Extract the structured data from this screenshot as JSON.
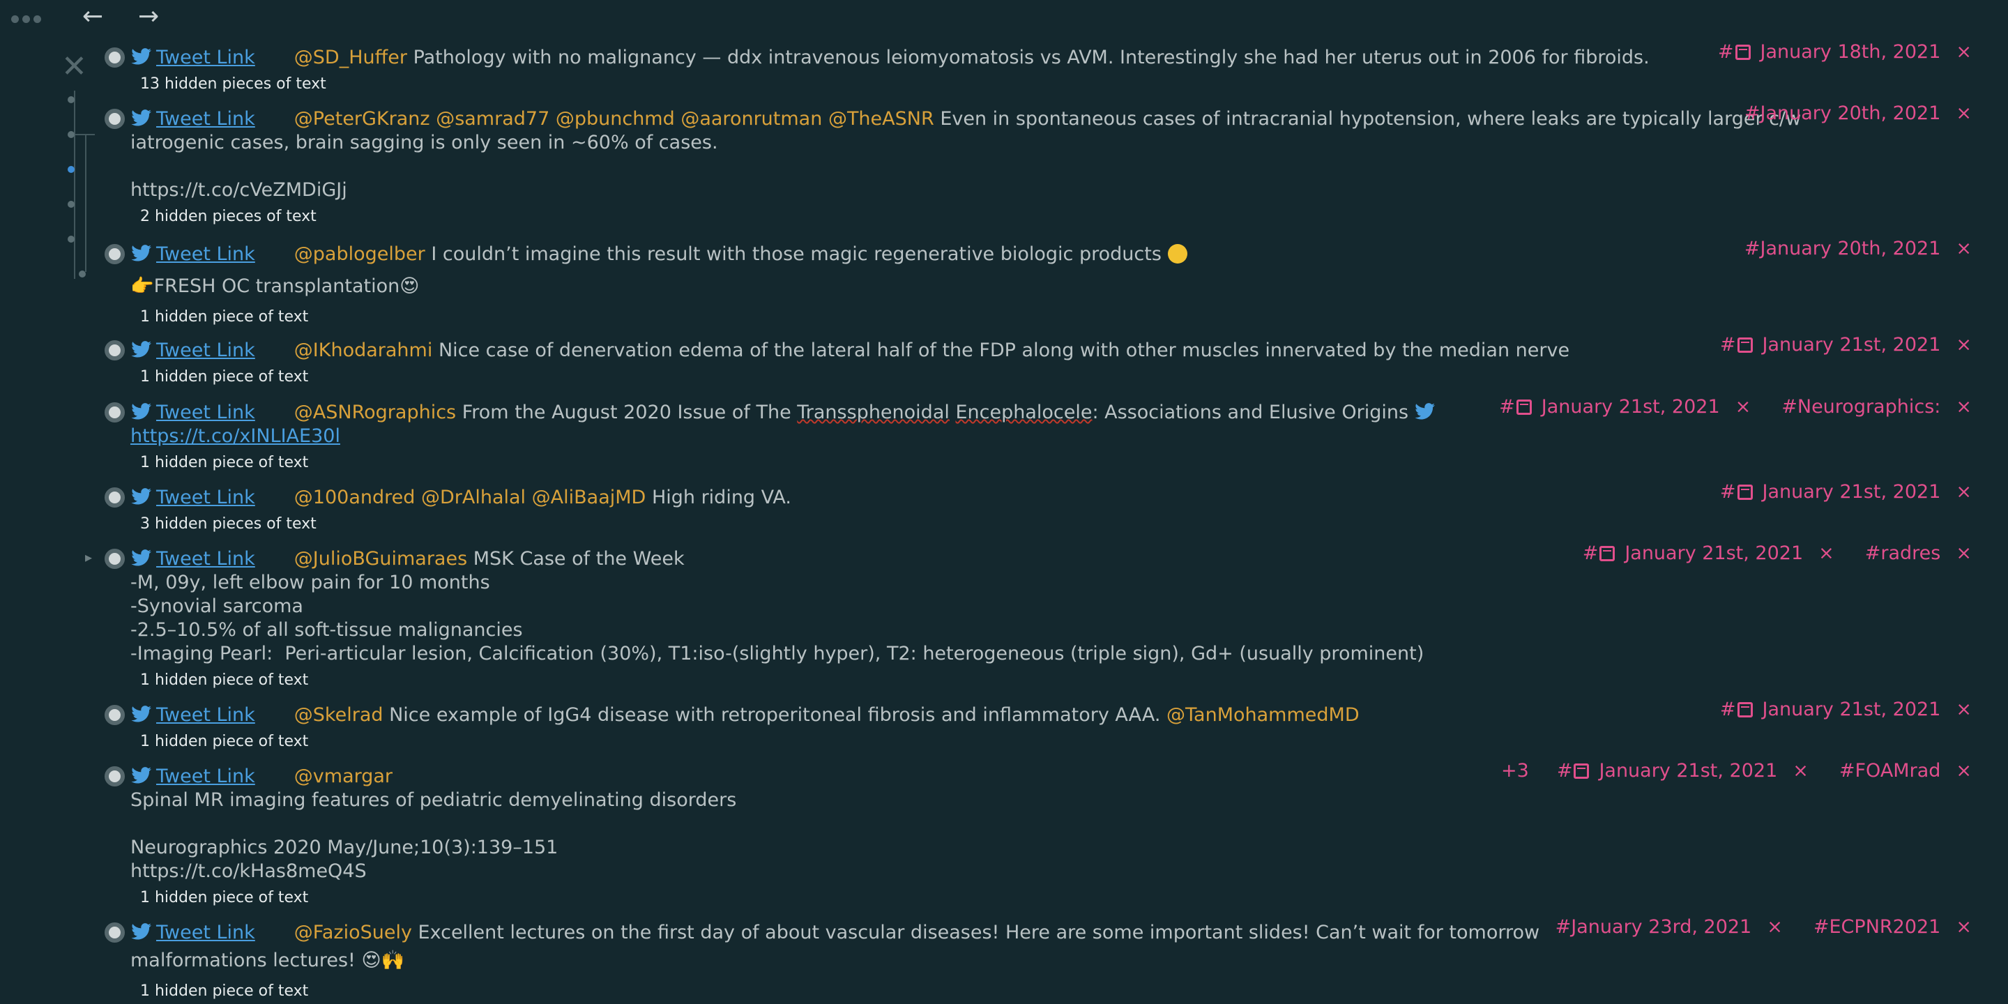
{
  "nav": {
    "menu_icon": "ellipsis-icon",
    "back_icon": "arrow-left-icon",
    "forward_icon": "arrow-right-icon",
    "back_glyph": "←",
    "forward_glyph": "→",
    "close_glyph": "✕"
  },
  "common": {
    "tweet_link": "Tweet Link",
    "hash": "#",
    "remove": "×"
  },
  "blocks": [
    {
      "mentions": [
        "@SD_Huffer"
      ],
      "text": "Pathology with no malignancy — ddx intravenous leiomyomatosis vs AVM. Interestingly she had her uterus out in 2006 for fibroids.",
      "hidden": "13 hidden pieces of text",
      "tags": [
        {
          "date": "January 18th, 2021"
        }
      ]
    },
    {
      "mentions": [
        "@PeterGKranz",
        "@samrad77",
        "@pbunchmd",
        "@aaronrutman",
        "@TheASNR"
      ],
      "text": "Even in spontaneous cases of intracranial hypotension, where leaks are typically larger c/w",
      "continuation": "iatrogenic cases, brain sagging is only seen in ~60% of cases.\n\nhttps://t.co/cVeZMDiGJj",
      "hidden": "2 hidden pieces of text",
      "tags": [
        {
          "date": "January 20th, 2021"
        }
      ]
    },
    {
      "mentions": [
        "@pablogelber"
      ],
      "text": "I couldn’t imagine this result with those magic regenerative biologic products",
      "continuation": "👉FRESH OC transplantation😍",
      "hidden": "1 hidden piece of text",
      "tags": [
        {
          "date": "January 20th, 2021"
        }
      ]
    },
    {
      "mentions": [
        "@IKhodarahmi"
      ],
      "text": "Nice case of denervation edema of the lateral half of the FDP along with other muscles innervated by the median nerve",
      "hidden": "1 hidden piece of text",
      "tags": [
        {
          "date": "January 21st, 2021"
        }
      ]
    },
    {
      "mentions": [
        "@ASNRographics"
      ],
      "text_a": "From the August 2020 Issue of  The ",
      "text_squiggle_1": "Transsphenoidal",
      "text_b": " ",
      "text_squiggle_2": "Encephalocele",
      "text_c": ": Associations and Elusive Origins",
      "url": "https://t.co/xINLIAE30l",
      "hidden": "1 hidden piece of text",
      "tags": [
        {
          "date": "January 21st, 2021"
        },
        {
          "label": "Neurographics:"
        }
      ]
    },
    {
      "mentions": [
        "@100andred",
        "@DrAlhalal",
        "@AliBaajMD"
      ],
      "text": "High riding VA.",
      "hidden": "3 hidden pieces of text",
      "tags": [
        {
          "date": "January 21st, 2021"
        }
      ]
    },
    {
      "mentions": [
        "@JulioBGuimaraes"
      ],
      "text": "MSK Case of the Week",
      "continuation": "-M, 09y, left elbow pain for 10 months\n-Synovial sarcoma\n-2.5–10.5% of all soft-tissue malignancies\n-Imaging Pearl:  Peri-articular lesion, Calcification (30%), T1:iso-(slightly hyper), T2: heterogeneous (triple sign), Gd+ (usually prominent)",
      "hidden": "1 hidden piece of text",
      "tags": [
        {
          "date": "January 21st, 2021"
        },
        {
          "label": "radres"
        }
      ]
    },
    {
      "mentions": [
        "@Skelrad"
      ],
      "text": "Nice example of IgG4 disease with retroperitoneal fibrosis and inflammatory AAA.",
      "trailing_mention": "@TanMohammedMD",
      "hidden": "1 hidden piece of text",
      "tags": [
        {
          "date": "January 21st, 2021"
        }
      ]
    },
    {
      "mentions": [
        "@vmargar"
      ],
      "text": "",
      "continuation": "Spinal MR imaging features of pediatric demyelinating disorders\n\nNeurographics 2020 May/June;10(3):139–151\nhttps://t.co/kHas8meQ4S",
      "hidden": "1 hidden piece of text",
      "extra_count": "+3",
      "tags": [
        {
          "date": "January 21st, 2021"
        },
        {
          "label": "FOAMrad"
        }
      ]
    },
    {
      "mentions": [
        "@FazioSuely"
      ],
      "text": "Excellent lectures on the first day of  about vascular diseases! Here are some important slides! Can’t wait for tomorrow",
      "continuation": "malformations lectures! 😍🙌",
      "hidden": "1 hidden piece of text",
      "tags": [
        {
          "label": "January 23rd, 2021"
        },
        {
          "label": "ECPNR2021"
        }
      ]
    }
  ]
}
